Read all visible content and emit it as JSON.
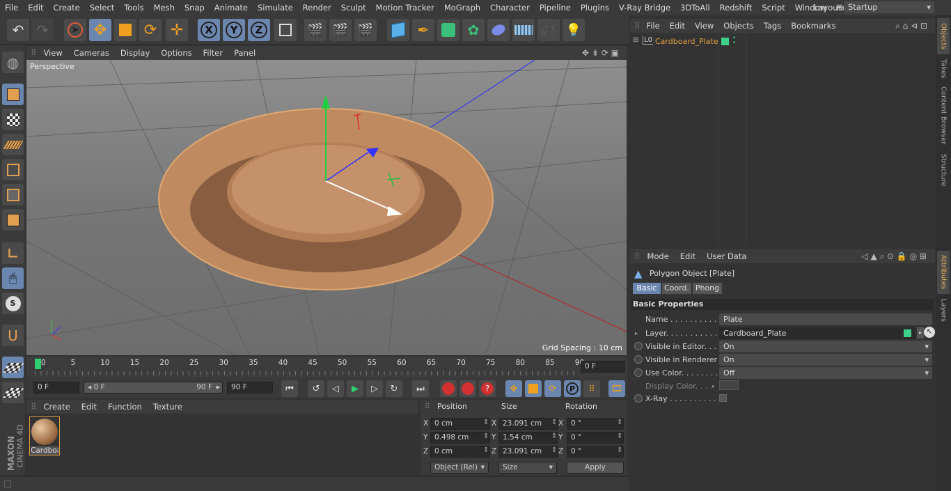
{
  "menu": [
    "File",
    "Edit",
    "Create",
    "Select",
    "Tools",
    "Mesh",
    "Snap",
    "Animate",
    "Simulate",
    "Render",
    "Sculpt",
    "Motion Tracker",
    "MoGraph",
    "Character",
    "Pipeline",
    "Plugins",
    "V-Ray Bridge",
    "3DToAll",
    "Redshift",
    "Script",
    "Window",
    "Help"
  ],
  "layout": {
    "label": "Layout:",
    "value": "Startup"
  },
  "viewport": {
    "menu": [
      "View",
      "Cameras",
      "Display",
      "Options",
      "Filter",
      "Panel"
    ],
    "label": "Perspective",
    "grid_spacing": "Grid Spacing : 10 cm"
  },
  "timeline": {
    "ticks": [
      "0",
      "5",
      "10",
      "15",
      "20",
      "25",
      "30",
      "35",
      "40",
      "45",
      "50",
      "55",
      "60",
      "65",
      "70",
      "75",
      "80",
      "85",
      "90"
    ],
    "frame_end_field": "0 F"
  },
  "playback": {
    "start": "0 F",
    "range_start": "0 F",
    "range_end": "90 F",
    "end": "90 F"
  },
  "material": {
    "menu": [
      "Create",
      "Edit",
      "Function",
      "Texture"
    ],
    "item": "Cardboa"
  },
  "coords": {
    "headers": [
      "Position",
      "Size",
      "Rotation"
    ],
    "rows": [
      {
        "axis": "X",
        "pos": "0 cm",
        "size_axis": "X",
        "size": "23.091 cm",
        "rot_axis": "X",
        "rot": "0 °"
      },
      {
        "axis": "Y",
        "pos": "0.498 cm",
        "size_axis": "Y",
        "size": "1.54 cm",
        "rot_axis": "Y",
        "rot": "0 °"
      },
      {
        "axis": "Z",
        "pos": "0 cm",
        "size_axis": "Z",
        "size": "23.091 cm",
        "rot_axis": "Z",
        "rot": "0 °"
      }
    ],
    "mode": "Object (Rel)",
    "size_mode": "Size",
    "apply": "Apply"
  },
  "objects": {
    "menu": [
      "File",
      "Edit",
      "View",
      "Objects",
      "Tags",
      "Bookmarks"
    ],
    "item": "Cardboard_Plate",
    "layer_tag": "L0"
  },
  "attributes": {
    "menu": [
      "Mode",
      "Edit",
      "User Data"
    ],
    "title": "Polygon Object [Plate]",
    "tabs": [
      "Basic",
      "Coord.",
      "Phong"
    ],
    "section": "Basic Properties",
    "props": [
      {
        "label": "Name . . . . . . . . . . .",
        "value": "Plate"
      },
      {
        "label": "Layer. . . . . . . . . . .",
        "value": "Cardboard_Plate"
      },
      {
        "label": "Visible in Editor. . .",
        "value": "On"
      },
      {
        "label": "Visible in Renderer",
        "value": "On"
      },
      {
        "label": "Use Color. . . . . . . .",
        "value": "Off"
      },
      {
        "label": "Display Color. . . .",
        "value": ""
      },
      {
        "label": "X-Ray . . . . . . . . . .",
        "value": ""
      }
    ]
  },
  "right_tabs": [
    "Objects",
    "Takes",
    "Content Browser",
    "Structure",
    "Attributes",
    "Layers"
  ],
  "brand": {
    "maker": "MAXON",
    "product": "CINEMA 4D"
  },
  "colors": {
    "accent": "#6b87b0",
    "plate": "#c08a60",
    "layer": "#3fd08a",
    "highlight": "#e0a040"
  }
}
